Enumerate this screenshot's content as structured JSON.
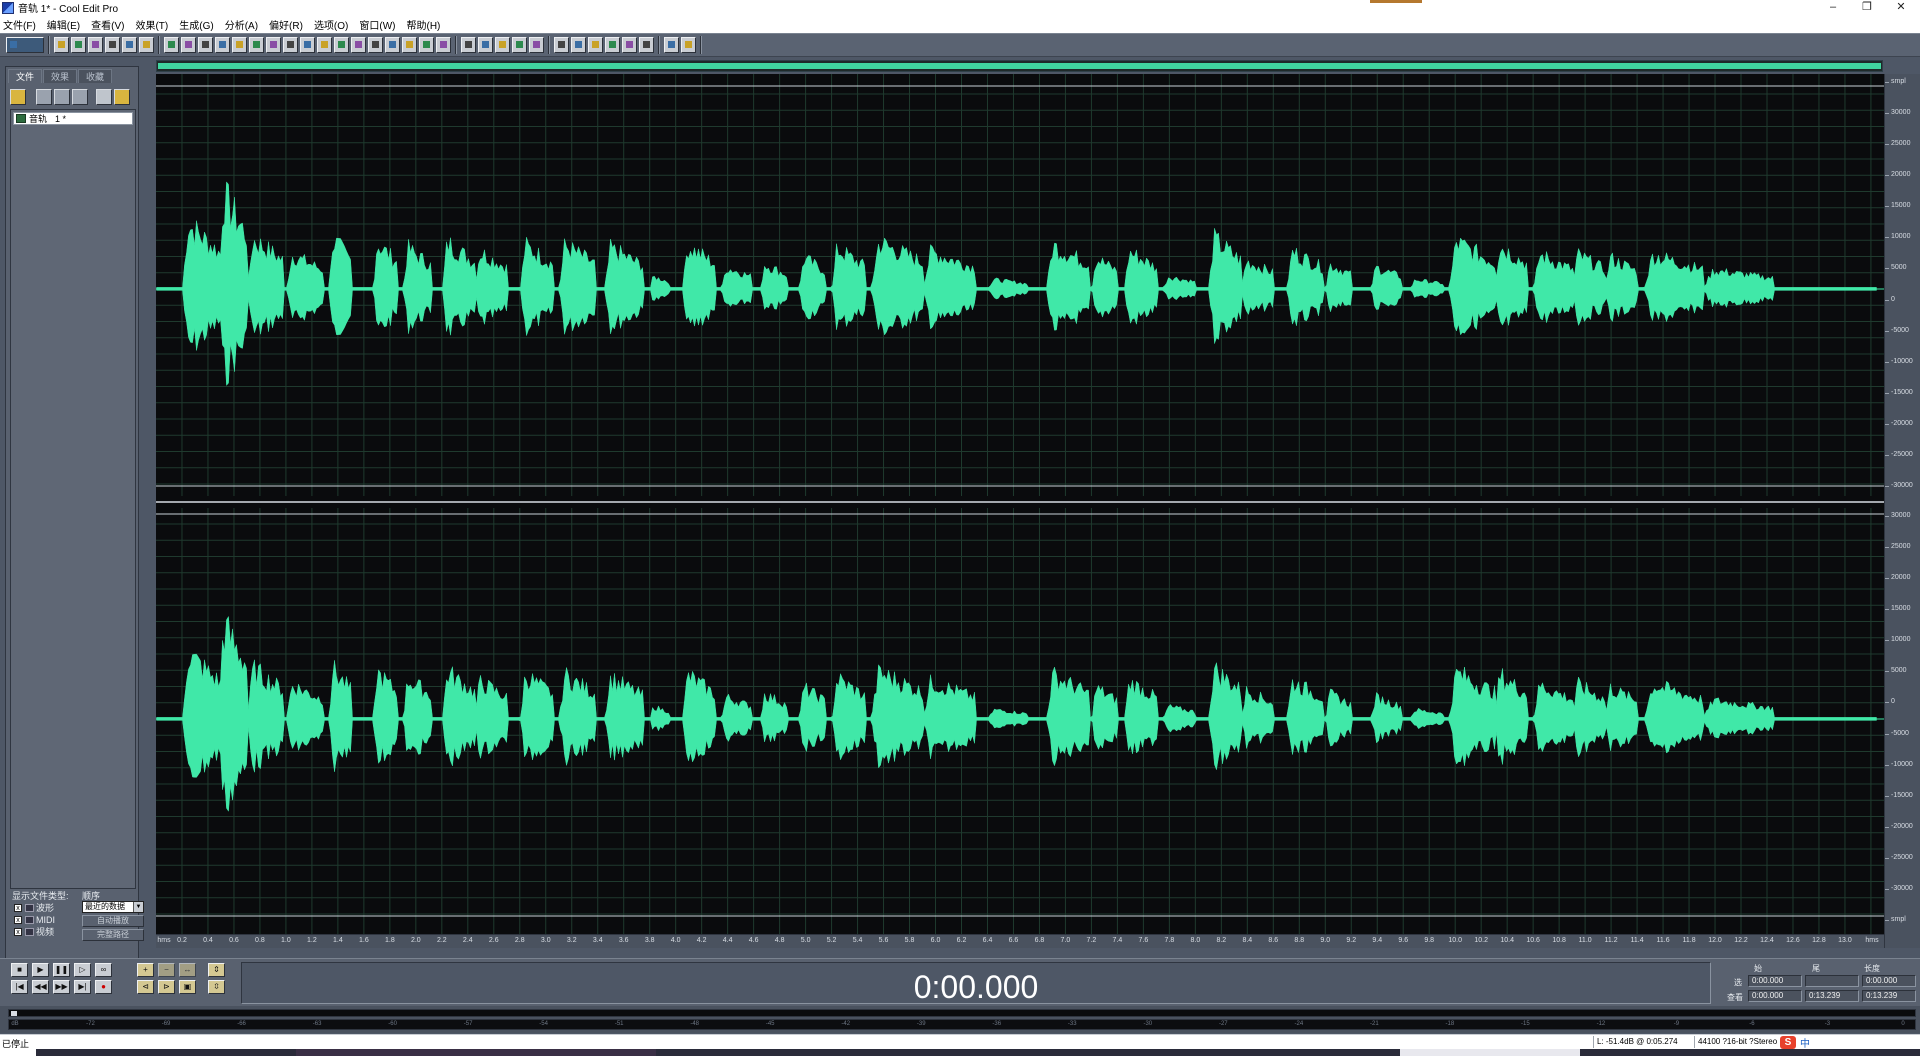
{
  "window": {
    "title": "音轨  1* - Cool Edit Pro",
    "minimize": "–",
    "restore": "❐",
    "close": "✕"
  },
  "menu": [
    "文件(F)",
    "编辑(E)",
    "查看(V)",
    "效果(T)",
    "生成(G)",
    "分析(A)",
    "偏好(R)",
    "选项(O)",
    "窗口(W)",
    "帮助(H)"
  ],
  "toolbar": {
    "icons": [
      "multitrack-toggle-icon",
      "new-file-icon",
      "open-file-icon",
      "open-append-icon",
      "close-file-icon",
      "save-icon",
      "save-as-icon",
      "undo-icon",
      "redo-icon",
      "repeat-last-icon",
      "cut-icon",
      "copy-icon",
      "paste-icon",
      "paste-new-icon",
      "mix-paste-icon",
      "trim-icon",
      "delete-icon",
      "crop-icon",
      "snap-icon",
      "zoom-tool-icon",
      "envelope-icon",
      "waveform-view-icon",
      "spectral-view-icon",
      "spectral-bars-icon",
      "meter-icon",
      "cue-list-icon",
      "play-list-icon",
      "preferences-icon",
      "settings-icon",
      "script-icon",
      "help-icon",
      "edit-view-icon",
      "align-icon",
      "mixer-icon",
      "properties-icon",
      "about-icon",
      "info-icon"
    ]
  },
  "left_panel": {
    "tabs": [
      "文件",
      "效果",
      "收藏"
    ],
    "active_tab": 0,
    "files": [
      {
        "name": "音轨",
        "suffix": "1 *"
      }
    ],
    "show_types_label": "显示文件类型:",
    "sort_label": "顺序",
    "sort_value": "最近的数据",
    "types": [
      {
        "label": "波形",
        "checked": true
      },
      {
        "label": "MIDI",
        "checked": true
      },
      {
        "label": "视频",
        "checked": true
      }
    ],
    "btn_auto_play": "自动播放",
    "btn_full_path": "完整路径"
  },
  "waveform": {
    "color": "#40e8a8",
    "grid_color": "#1f3a2e",
    "background": "#0a0b0d",
    "channels": 2,
    "amplitude_ticks": [
      "smpl",
      "30000",
      "25000",
      "20000",
      "15000",
      "10000",
      "5000",
      "0",
      "-5000",
      "-10000",
      "-15000",
      "-20000",
      "-25000",
      "-30000"
    ],
    "amplitude_ticks_bottom": [
      "30000",
      "25000",
      "20000",
      "15000",
      "10000",
      "5000",
      "0",
      "-5000",
      "-10000",
      "-15000",
      "-20000",
      "-25000",
      "-30000",
      "smpl"
    ],
    "time_labels": [
      "hms",
      "0.2",
      "0.4",
      "0.6",
      "0.8",
      "1.0",
      "1.2",
      "1.4",
      "1.6",
      "1.8",
      "2.0",
      "2.2",
      "2.4",
      "2.6",
      "2.8",
      "3.0",
      "3.2",
      "3.4",
      "3.6",
      "3.8",
      "4.0",
      "4.2",
      "4.4",
      "4.6",
      "4.8",
      "5.0",
      "5.2",
      "5.4",
      "5.6",
      "5.8",
      "6.0",
      "6.2",
      "6.4",
      "6.6",
      "6.8",
      "7.0",
      "7.2",
      "7.4",
      "7.6",
      "7.8",
      "8.0",
      "8.2",
      "8.4",
      "8.6",
      "8.8",
      "9.0",
      "9.2",
      "9.4",
      "9.6",
      "9.8",
      "10.0",
      "10.2",
      "10.4",
      "10.6",
      "10.8",
      "11.0",
      "11.2",
      "11.4",
      "11.6",
      "11.8",
      "12.0",
      "12.2",
      "12.4",
      "12.6",
      "12.8",
      "13.0",
      "hms"
    ],
    "duration_seconds": 13.239
  },
  "transport": {
    "row1": [
      "■",
      "▶",
      "❚❚",
      "▷",
      "∞"
    ],
    "row2": [
      "|◀",
      "◀◀",
      "▶▶",
      "▶|",
      "●"
    ],
    "time": "0:00.000"
  },
  "selection": {
    "headers": [
      "始",
      "尾",
      "长度"
    ],
    "rows": [
      {
        "label": "选",
        "start": "0:00.000",
        "end": "",
        "length": "0:00.000"
      },
      {
        "label": "查看",
        "start": "0:00.000",
        "end": "0:13.239",
        "length": "0:13.239"
      }
    ]
  },
  "level_scale": [
    "dB",
    "-72",
    "-69",
    "-66",
    "-63",
    "-60",
    "-57",
    "-54",
    "-51",
    "-48",
    "-45",
    "-42",
    "-39",
    "-36",
    "-33",
    "-30",
    "-27",
    "-24",
    "-21",
    "-18",
    "-15",
    "-12",
    "-9",
    "-6",
    "-3",
    "0"
  ],
  "status": {
    "state": "已停止",
    "cursor": "L: -51.4dB @   0:05.274",
    "format": "44100 ?16-bit ?Stereo",
    "ime_glyph": "S",
    "ime_lang": "中"
  }
}
